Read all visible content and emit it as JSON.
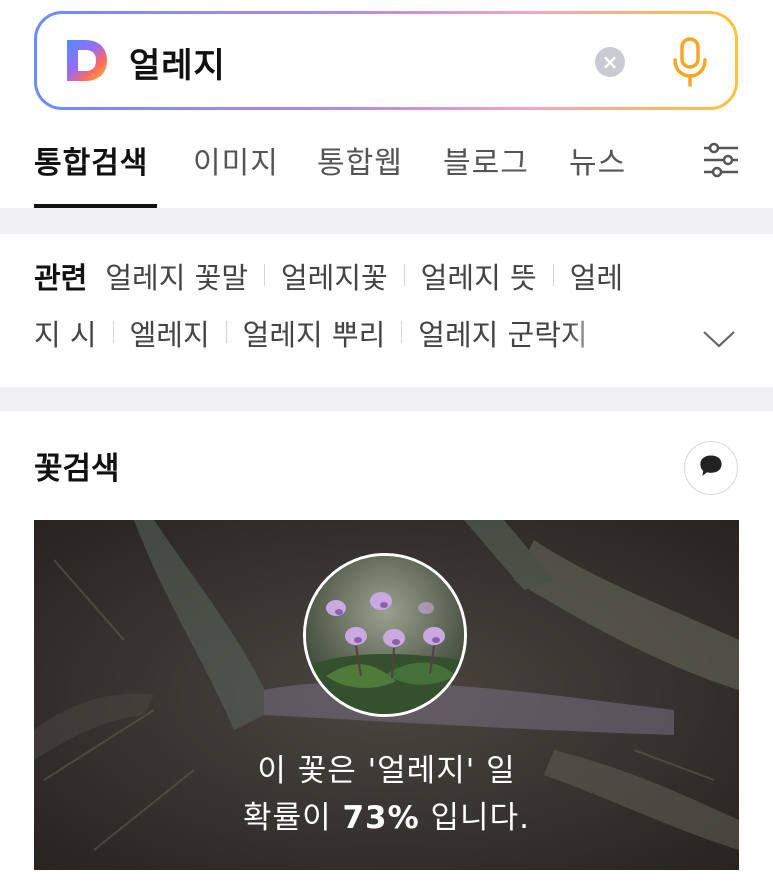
{
  "search": {
    "query": "얼레지",
    "clear_symbol": "×"
  },
  "tabs": [
    {
      "label": "통합검색",
      "active": true
    },
    {
      "label": "이미지"
    },
    {
      "label": "통합웹"
    },
    {
      "label": "블로그"
    },
    {
      "label": "뉴스"
    }
  ],
  "related": {
    "title": "관련",
    "items": [
      "얼레지 꽃말",
      "얼레지꽃",
      "얼레지 뜻",
      "얼레지 시",
      "엘레지",
      "얼레지 뿌리",
      "얼레지 군락지"
    ],
    "line1_tail": "얼레",
    "line2_head": "지 시",
    "line2_tail_truncated": "얼레지 군락지"
  },
  "flower_search": {
    "title": "꽃검색",
    "result_line1": "이 꽃은 '얼레지' 일",
    "result_prefix": "확률이 ",
    "probability": "73%",
    "result_suffix": " 입니다."
  },
  "colors": {
    "search_border_start": "#6c8bff",
    "search_border_end": "#ffc23a",
    "mic_color": "#f5a623",
    "active_tab": "#111111"
  },
  "icons": [
    "daum-logo-icon",
    "clear-icon",
    "microphone-icon",
    "filter-settings-icon",
    "chevron-down-icon",
    "chat-bubble-icon"
  ]
}
